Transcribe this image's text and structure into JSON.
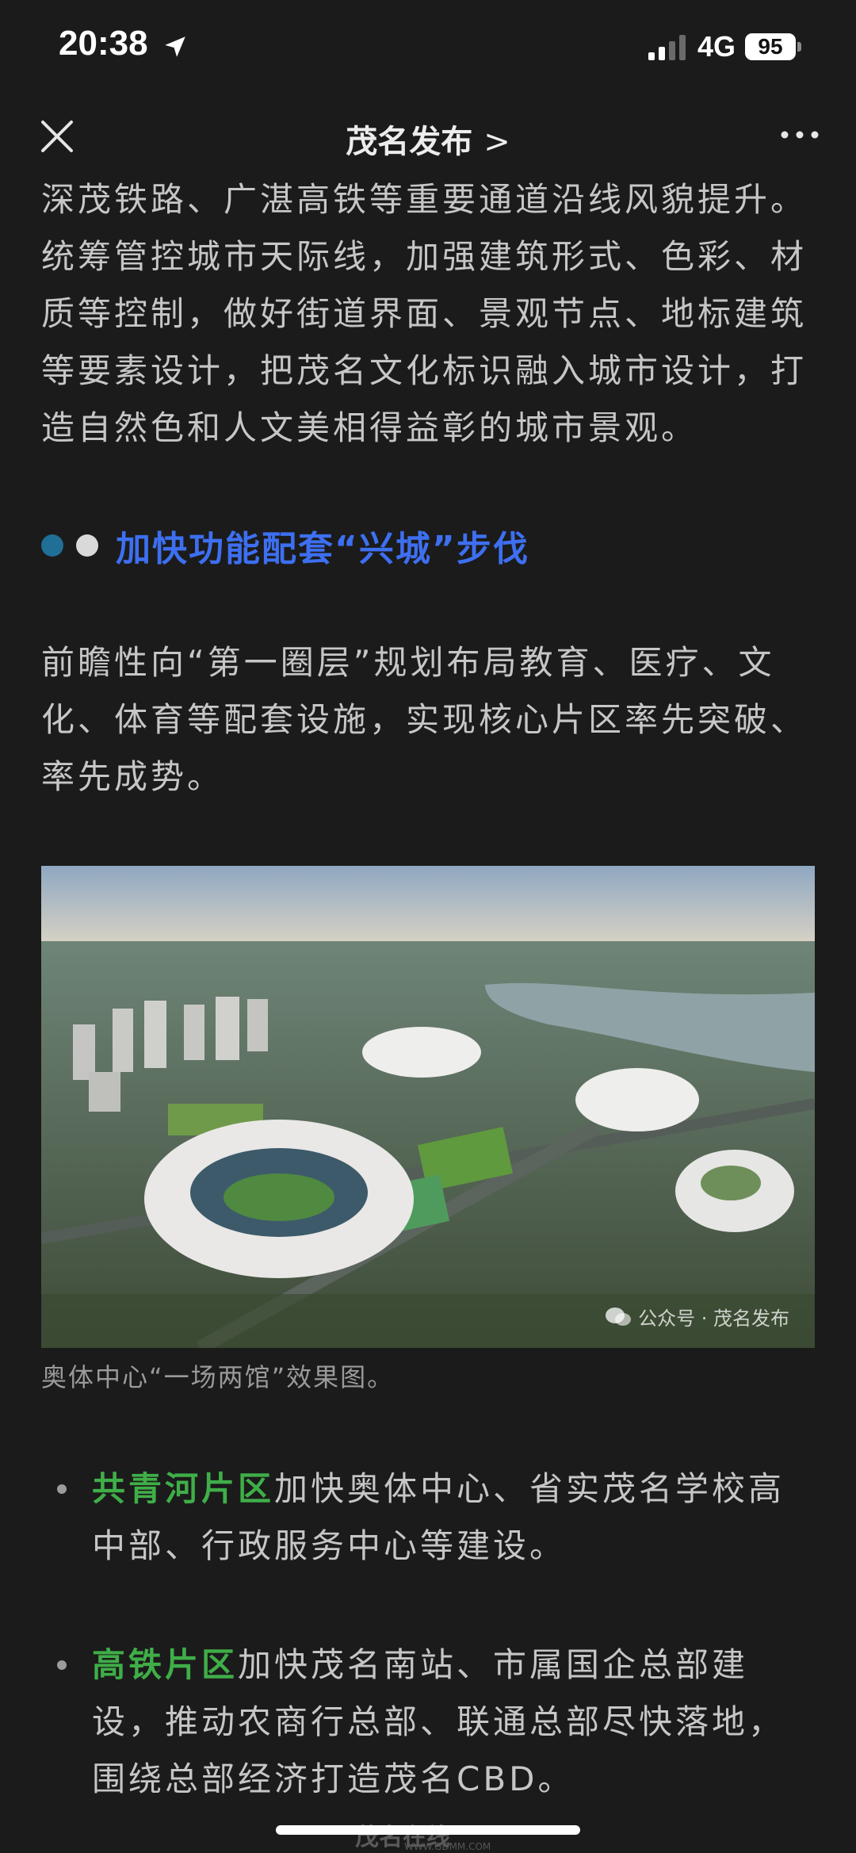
{
  "status_bar": {
    "time": "20:38",
    "network": "4G",
    "battery": "95"
  },
  "nav": {
    "title": "茂名发布",
    "chevron": ">"
  },
  "article": {
    "paragraph_1": "深茂铁路、广湛高铁等重要通道沿线风貌提升。统筹管控城市天际线，加强建筑形式、色彩、材质等控制，做好街道界面、景观节点、地标建筑等要素设计，把茂名文化标识融入城市设计，打造自然色和人文美相得益彰的城市景观。",
    "section_heading": "加快功能配套“兴城”步伐",
    "paragraph_2": "前瞻性向“第一圈层”规划布局教育、医疗、文化、体育等配套设施，实现核心片区率先突破、率先成势。",
    "image_watermark": "公众号 · 茂名发布",
    "image_caption": "奥体中心“一场两馆”效果图。",
    "bullets": [
      {
        "highlight": "共青河片区",
        "text": "加快奥体中心、省实茂名学校高中部、行政服务中心等建设。"
      },
      {
        "highlight": "高铁片区",
        "text": "加快茂名南站、市属国企总部建设，推动农商行总部、联通总部尽快落地，围绕总部经济打造茂名CBD。"
      }
    ]
  },
  "footer": {
    "logo_text": "茂名在线",
    "url": "WWW.GDMM.COM"
  },
  "colors": {
    "background": "#1b1b1b",
    "heading_blue": "#3d6ff0",
    "highlight_green": "#3fae48"
  },
  "icons": [
    "location-arrow-icon",
    "signal-icon",
    "close-icon",
    "more-icon",
    "wechat-icon"
  ]
}
